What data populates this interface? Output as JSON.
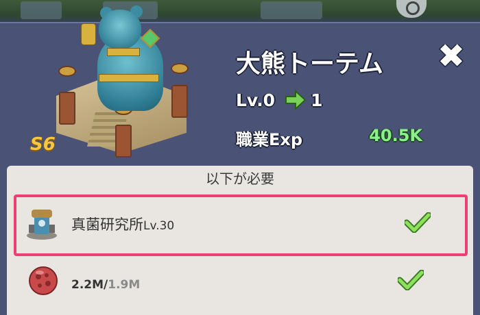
{
  "building": {
    "title": "大熊トーテム",
    "season_badge": "S6",
    "level_from": "Lv.0",
    "level_to": "1",
    "exp_label": "職業Exp",
    "exp_value": "40.5K"
  },
  "requirements": {
    "header": "以下が必要",
    "items": [
      {
        "name": "真菌研究所",
        "level": "Lv.30",
        "icon": "research-lab-icon",
        "met": true
      },
      {
        "current": "2.2M",
        "separator": "/",
        "required": "1.9M",
        "icon": "resource-orb-icon",
        "met": true
      }
    ]
  },
  "colors": {
    "panel_bg": "#4a5375",
    "highlight": "#ee3f74",
    "check_green": "#7bd05a",
    "exp_value": "#8cf08a",
    "badge_gold": "#f5c844"
  },
  "icons": {
    "close": "close-icon",
    "arrow": "arrow-right-icon",
    "check": "checkmark-icon",
    "map": "map-search-icon"
  }
}
